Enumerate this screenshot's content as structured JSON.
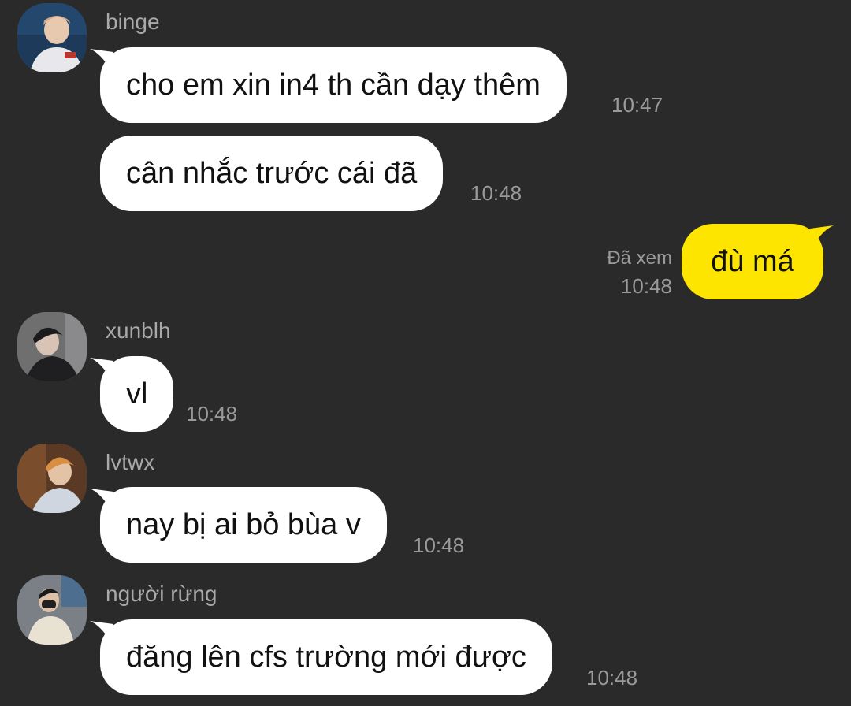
{
  "messages": [
    {
      "sender": "binge",
      "text": "cho em xin in4 th cần dạy thêm",
      "time": "10:47"
    },
    {
      "text": "cân nhắc trước cái đã",
      "time": "10:48"
    },
    {
      "outgoing": true,
      "text": "đù má",
      "status": "Đã xem",
      "time": "10:48"
    },
    {
      "sender": "xunblh",
      "text": "vl",
      "time": "10:48"
    },
    {
      "sender": "lvtwx",
      "text": "nay bị ai bỏ bùa v",
      "time": "10:48"
    },
    {
      "sender": "người rừng",
      "text": "đăng lên cfs trường mới được",
      "time": "10:48"
    }
  ],
  "colors": {
    "background": "#2a2a2a",
    "incoming_bubble": "#ffffff",
    "outgoing_bubble": "#fee500",
    "meta_text": "#9a9a9a"
  }
}
